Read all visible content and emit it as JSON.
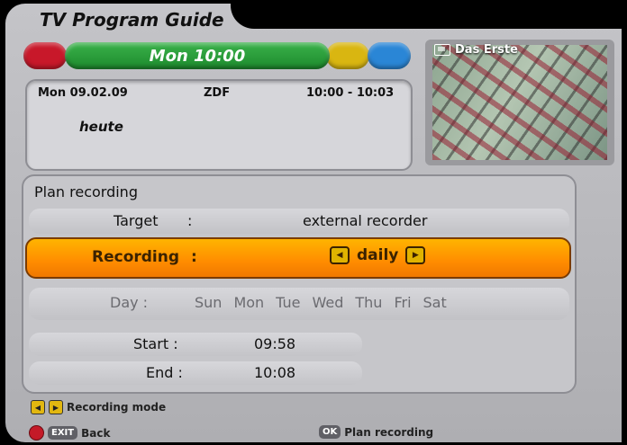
{
  "title": "TV Program Guide",
  "colorbar": {
    "green_label": "Mon 10:00"
  },
  "info": {
    "date": "Mon 09.02.09",
    "channel": "ZDF",
    "time": "10:00 - 10:03",
    "program": "heute"
  },
  "preview": {
    "channel": "Das Erste"
  },
  "plan": {
    "heading": "Plan recording",
    "target_label": "Target",
    "target_value": "external recorder",
    "recording_label": "Recording",
    "recording_value": "daily",
    "day_label": "Day :",
    "days": [
      "Sun",
      "Mon",
      "Tue",
      "Wed",
      "Thu",
      "Fri",
      "Sat"
    ],
    "start_label": "Start",
    "start_value": "09:58",
    "end_label": "End",
    "end_value": "10:08",
    "colon": ":"
  },
  "hints": {
    "mode": "Recording mode",
    "back_key": "EXIT",
    "back": "Back",
    "ok_key": "OK",
    "plan": "Plan recording"
  },
  "colors": {
    "red": "#c8182a",
    "green": "#2a9e3a",
    "yellow": "#d9b611",
    "blue": "#2a86d6",
    "highlight": "#ff9a00"
  },
  "icons": [
    "tv-icon",
    "left-arrow-icon",
    "right-arrow-icon",
    "red-button-icon",
    "exit-key-icon",
    "ok-key-icon"
  ]
}
